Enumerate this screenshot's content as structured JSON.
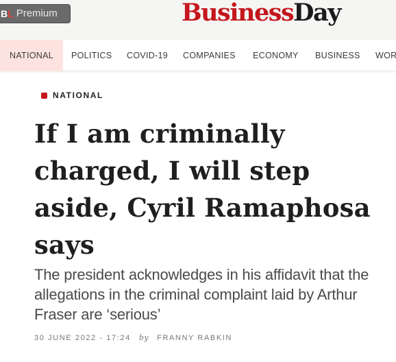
{
  "header": {
    "premium_badge": {
      "bl_b": "B",
      "bl_l": "L",
      "label": "Premium"
    },
    "logo": {
      "part1": "Business",
      "part2": "Day"
    }
  },
  "nav": {
    "items": [
      {
        "label": "NATIONAL",
        "active": true
      },
      {
        "label": "POLITICS"
      },
      {
        "label": "COVID-19"
      },
      {
        "label": "COMPANIES"
      },
      {
        "label": "ECONOMY"
      },
      {
        "label": "BUSINESS"
      },
      {
        "label": "WOR"
      }
    ]
  },
  "article": {
    "section": "NATIONAL",
    "headline": "If I am criminally charged, I will step aside, Cyril Ramaphosa says",
    "subheadline": "The president acknowledges in his affidavit that the allegations in the criminal complaint laid by Arthur Fraser are ‘serious’",
    "date": "30 JUNE 2022 - 17:24",
    "by": "by",
    "author": "FRANNY RABKIN"
  },
  "colors": {
    "brand_red": "#c4171d",
    "nav_active_bg": "#fde3df"
  }
}
